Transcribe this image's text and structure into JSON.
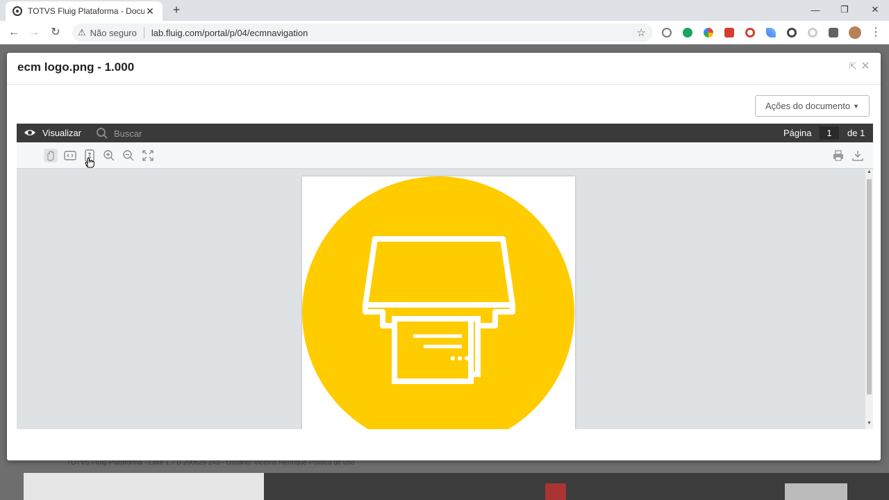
{
  "browser": {
    "tab_title": "TOTVS Fluig Plataforma - Docum",
    "tab_close": "✕",
    "new_tab": "+",
    "security_label": "Não seguro",
    "url": "lab.fluig.com/portal/p/04/ecmnavigation",
    "window_controls": {
      "minimize": "—",
      "restore": "❐",
      "close": "✕"
    }
  },
  "modal": {
    "title": "ecm logo.png - 1.000",
    "actions_button": "Ações do documento",
    "close_icon": "close-icon",
    "popout_icon": "external-window-icon"
  },
  "viewer": {
    "mode_label": "Visualizar",
    "search_placeholder": "Buscar",
    "page_label": "Página",
    "current_page": "1",
    "page_total": "de 1",
    "tools": [
      "hand-tool-icon",
      "fit-width-icon",
      "fit-page-icon",
      "zoom-in-icon",
      "zoom-out-icon",
      "fullscreen-icon"
    ],
    "right_tools": [
      "print-icon",
      "download-icon"
    ]
  },
  "background": {
    "footer": "TOTVS Fluig Plataforma - Lake 1.7.0-200629 243 - Usuário: Victória Henrique     Política de uso"
  },
  "colors": {
    "logo_yellow": "#ffcc00",
    "viewer_bar": "#3a3a3a",
    "viewer_bg": "#dfe2e5"
  }
}
